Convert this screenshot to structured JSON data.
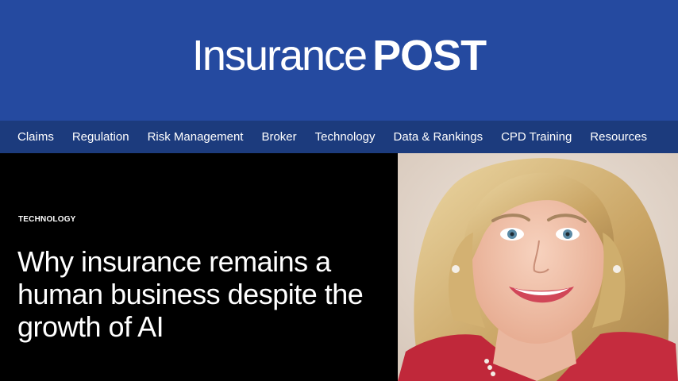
{
  "brand": {
    "logo_light": "Insurance",
    "logo_bold": "POST",
    "accent": "#254aa0",
    "nav_bg": "#1c3b7d"
  },
  "nav": {
    "items": [
      {
        "label": "Claims"
      },
      {
        "label": "Regulation"
      },
      {
        "label": "Risk Management"
      },
      {
        "label": "Broker"
      },
      {
        "label": "Technology"
      },
      {
        "label": "Data & Rankings"
      },
      {
        "label": "CPD Training"
      },
      {
        "label": "Resources"
      }
    ]
  },
  "article": {
    "category": "TECHNOLOGY",
    "headline": "Why insurance remains a human business despite the growth of AI"
  },
  "photo": {
    "icon": "portrait-photo"
  }
}
